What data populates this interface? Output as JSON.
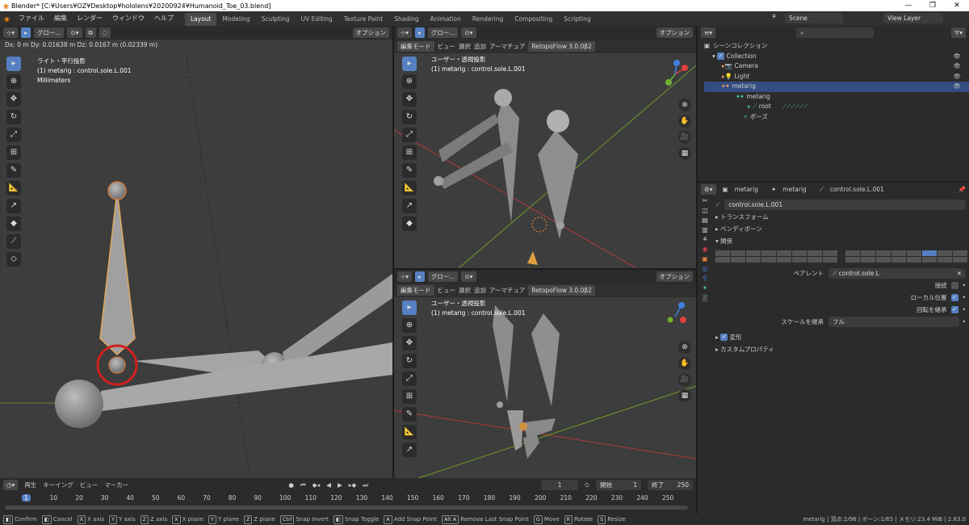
{
  "window": {
    "title": "Blender* [C:¥Users¥OZ¥Desktop¥hololens¥20200924¥Humanoid_Toe_03.blend]"
  },
  "menu": [
    "ファイル",
    "編集",
    "レンダー",
    "ウィンドウ",
    "ヘルプ"
  ],
  "workspaces": [
    "Layout",
    "Modeling",
    "Sculpting",
    "UV Editing",
    "Texture Paint",
    "Shading",
    "Animation",
    "Rendering",
    "Compositing",
    "Scripting"
  ],
  "scene": {
    "label": "Scene",
    "view_layer": "View Layer"
  },
  "left_view": {
    "transform_readout": "Dx: 0 m   Dy: 0.01638 m   Dz: 0.0167 m (0.02339 m)",
    "view_name": "ライト・平行投影",
    "object_line": "(1) metarig : control.sole.L.001",
    "units": "Millimeters",
    "header": {
      "transform_orientation": "グロー...",
      "options": "オプション"
    }
  },
  "top_view": {
    "mode": "編集モード",
    "menu": [
      "ビュー",
      "選択",
      "追加",
      "アーマチュア"
    ],
    "addon": "RetopoFlow 3.0.0β2",
    "view_name": "ユーザー・透視投影",
    "object_line": "(1) metarig : control.sole.L.001",
    "header": {
      "transform_orientation": "グロー...",
      "options": "オプション"
    }
  },
  "bottom_view": {
    "mode": "編集モード",
    "menu": [
      "ビュー",
      "選択",
      "追加",
      "アーマチュア"
    ],
    "addon": "RetopoFlow 3.0.0β2",
    "view_name": "ユーザー・透視投影",
    "object_line": "(1) metarig : control.sole.L.001",
    "header": {
      "transform_orientation": "グロー...",
      "options": "オプション"
    }
  },
  "outliner": {
    "search_placeholder": "",
    "rows": [
      {
        "label": "シーンコレクション"
      },
      {
        "label": "Collection"
      },
      {
        "label": "Camera"
      },
      {
        "label": "Light"
      },
      {
        "label": "metarig"
      },
      {
        "label": "metarig"
      },
      {
        "label": "root"
      },
      {
        "label": "ポーズ"
      }
    ]
  },
  "properties": {
    "breadcrumb": [
      "metarig",
      "metarig",
      "control.sole.L.001"
    ],
    "bone_name": "control.sole.L.001",
    "sections": {
      "transform": "トランスフォーム",
      "bendy": "ベンディボーン",
      "relations": "関係",
      "deform": "変形",
      "custom": "カスタムプロパティ"
    },
    "parent_label": "ペアレント",
    "parent_value": "control.sole.L",
    "connected_label": "接続",
    "local_loc_label": "ローカル位置",
    "inherit_rot_label": "回転を継承",
    "inherit_scale_label": "スケールを継承",
    "inherit_scale_value": "フル"
  },
  "timeline": {
    "menu": [
      "再生",
      "キーイング",
      "ビュー",
      "マーカー"
    ],
    "current_frame": "1",
    "start_label": "開始",
    "start": "1",
    "end_label": "終了",
    "end": "250",
    "ticks": [
      "1",
      "10",
      "20",
      "30",
      "40",
      "50",
      "60",
      "70",
      "80",
      "90",
      "100",
      "110",
      "120",
      "130",
      "140",
      "150",
      "160",
      "170",
      "180",
      "190",
      "200",
      "210",
      "220",
      "230",
      "240",
      "250"
    ]
  },
  "statusbar": {
    "items": [
      {
        "key": "",
        "label": "Confirm"
      },
      {
        "key": "",
        "label": "Cancel"
      },
      {
        "key": "X",
        "label": "X axis"
      },
      {
        "key": "Y",
        "label": "Y axis"
      },
      {
        "key": "Z",
        "label": "Z axis"
      },
      {
        "key": "X",
        "label": "X plane"
      },
      {
        "key": "Y",
        "label": "Y plane"
      },
      {
        "key": "Z",
        "label": "Z plane"
      },
      {
        "key": "Ctrl",
        "label": "Snap Invert"
      },
      {
        "key": "",
        "label": "Snap Toggle"
      },
      {
        "key": "A",
        "label": "Add Snap Point"
      },
      {
        "key": "Alt A",
        "label": "Remove Last Snap Point"
      },
      {
        "key": "G",
        "label": "Move"
      },
      {
        "key": "R",
        "label": "Rotate"
      },
      {
        "key": "S",
        "label": "Resize"
      }
    ],
    "info": "metarig | 頂点:2/96 | ボーン:1/65 | メモリ:23.4 MiB | 2.83.0"
  }
}
